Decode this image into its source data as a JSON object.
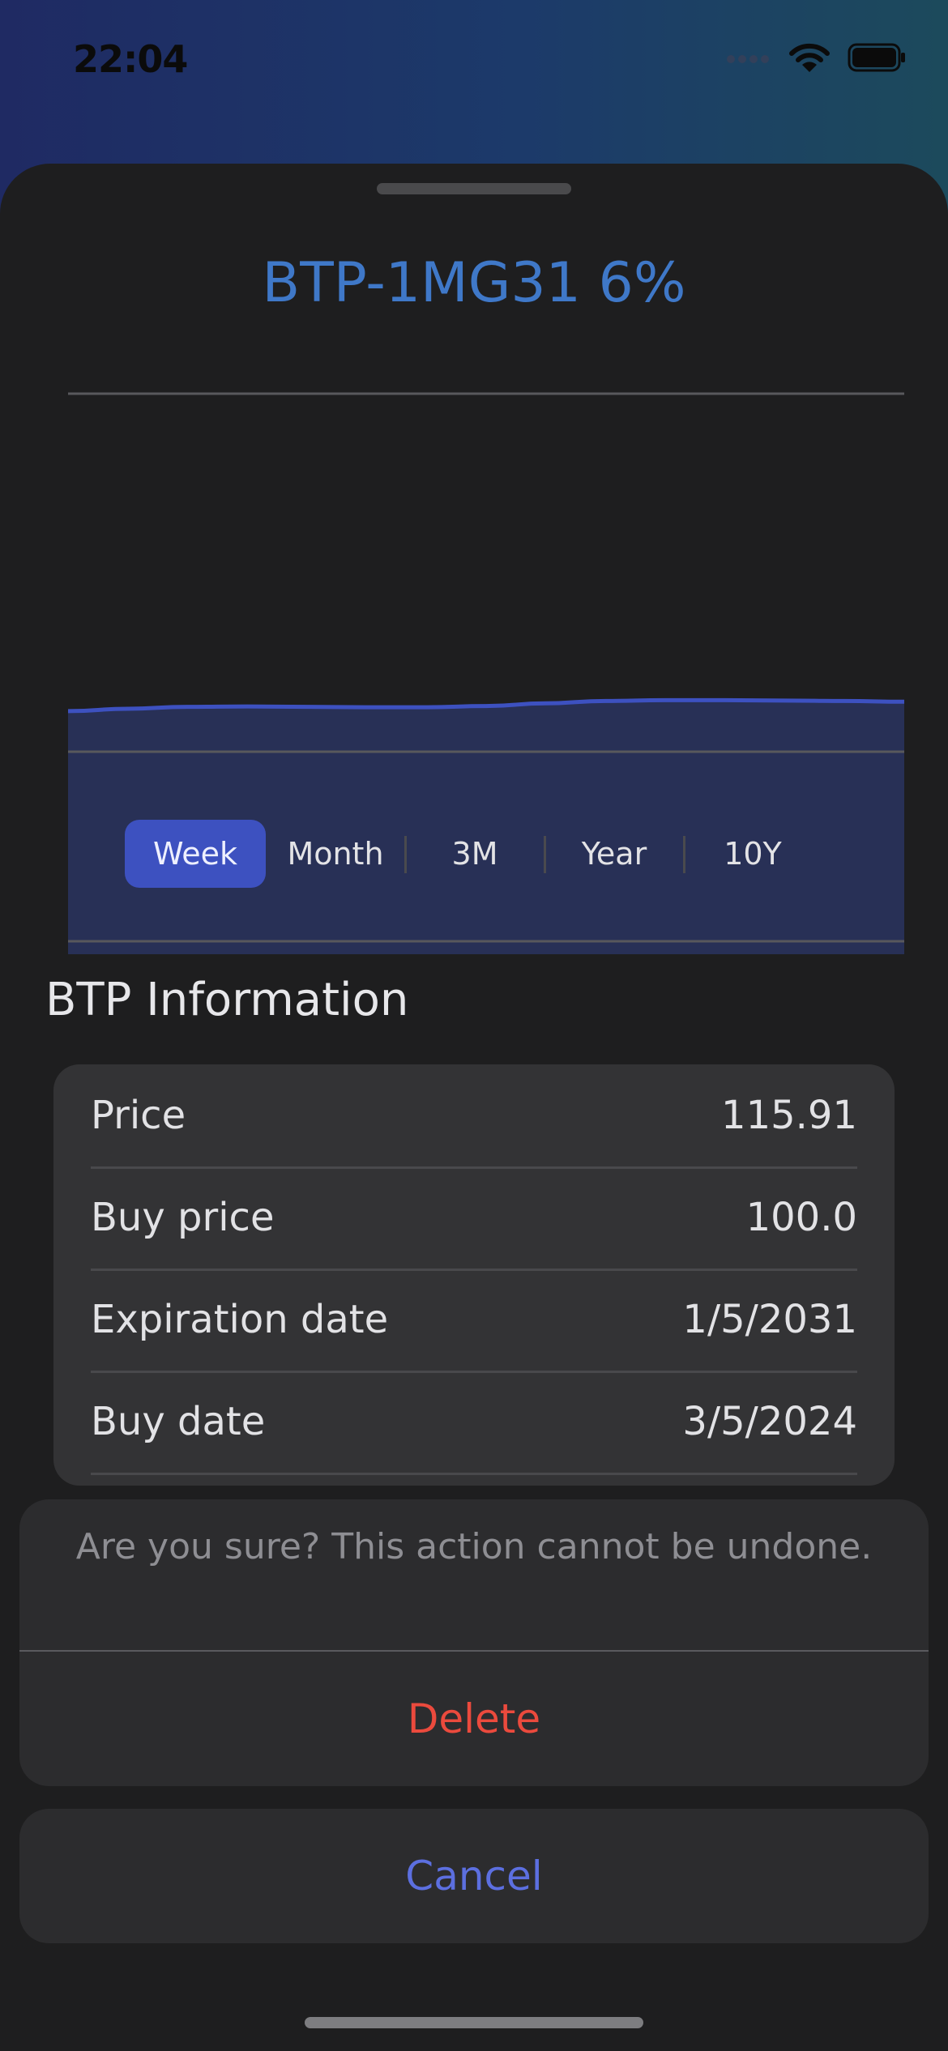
{
  "status_bar": {
    "time": "22:04"
  },
  "sheet": {
    "title": "BTP-1MG31 6%"
  },
  "chart_data": {
    "type": "area",
    "x": [
      0,
      1,
      2,
      3,
      4,
      5,
      6,
      7,
      8,
      9,
      10,
      11,
      12,
      13,
      14
    ],
    "values": [
      62.0,
      62.6,
      63.1,
      63.2,
      63.1,
      63.0,
      63.0,
      63.3,
      64.0,
      64.6,
      64.8,
      64.8,
      64.7,
      64.6,
      64.4
    ],
    "ylim": [
      0,
      100
    ],
    "grid": true,
    "gridlines": [
      0,
      50,
      100
    ],
    "line_color": "#3d51c0",
    "fill_color": "#283056",
    "grid_color": "#58585c"
  },
  "range_selector": {
    "options": [
      "Week",
      "Month",
      "3M",
      "Year",
      "10Y"
    ],
    "selected": "Week"
  },
  "info": {
    "heading": "BTP Information",
    "rows": [
      {
        "label": "Price",
        "value": "115.91"
      },
      {
        "label": "Buy price",
        "value": "100.0"
      },
      {
        "label": "Expiration date",
        "value": "1/5/2031"
      },
      {
        "label": "Buy date",
        "value": "3/5/2024"
      }
    ]
  },
  "action_sheet": {
    "message": "Are you sure? This action cannot be undone.",
    "destructive_label": "Delete",
    "cancel_label": "Cancel"
  },
  "colors": {
    "accent": "#3f78c8",
    "selected_segment": "#3d51c0",
    "destructive": "#eb4a3d",
    "cancel": "#5c6fe0"
  }
}
